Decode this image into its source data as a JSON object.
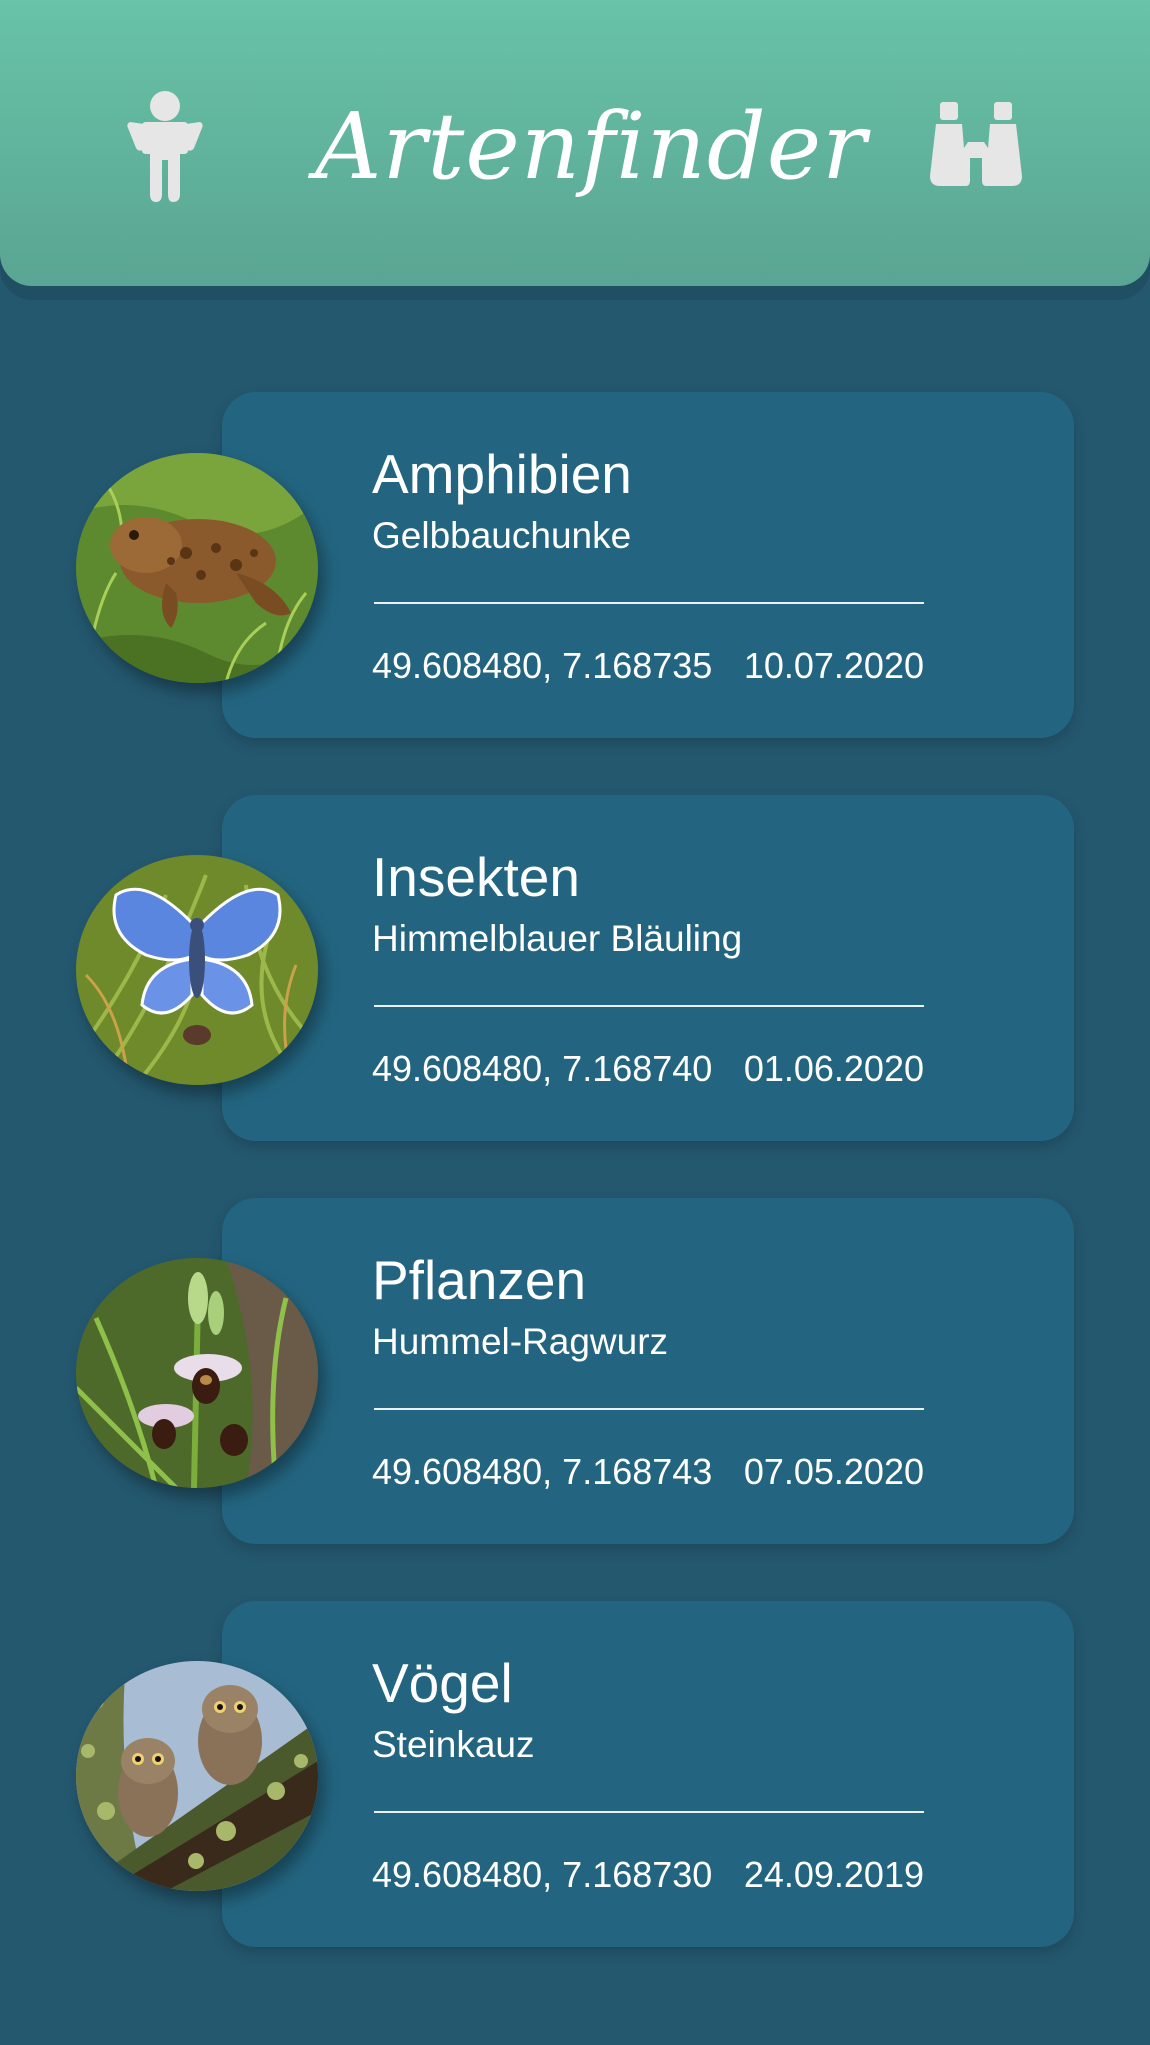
{
  "header": {
    "title": "Artenfinder",
    "left_icon": "person-icon",
    "right_icon": "binoculars-icon"
  },
  "sightings": [
    {
      "category": "Amphibien",
      "species": "Gelbbauchunke",
      "coords": "49.608480, 7.168735",
      "date": "10.07.2020",
      "image": "toad-photo"
    },
    {
      "category": "Insekten",
      "species": "Himmelblauer Bläuling",
      "coords": "49.608480, 7.168740",
      "date": "01.06.2020",
      "image": "butterfly-photo"
    },
    {
      "category": "Pflanzen",
      "species": "Hummel-Ragwurz",
      "coords": "49.608480, 7.168743",
      "date": "07.05.2020",
      "image": "orchid-photo"
    },
    {
      "category": "Vögel",
      "species": "Steinkauz",
      "coords": "49.608480, 7.168730",
      "date": "24.09.2019",
      "image": "owls-photo"
    }
  ],
  "colors": {
    "background": "#24586f",
    "header_top": "#68c3a7",
    "header_bottom": "#5aa593",
    "card": "#236580",
    "text": "#ffffff",
    "icon": "#e6e6e6"
  }
}
